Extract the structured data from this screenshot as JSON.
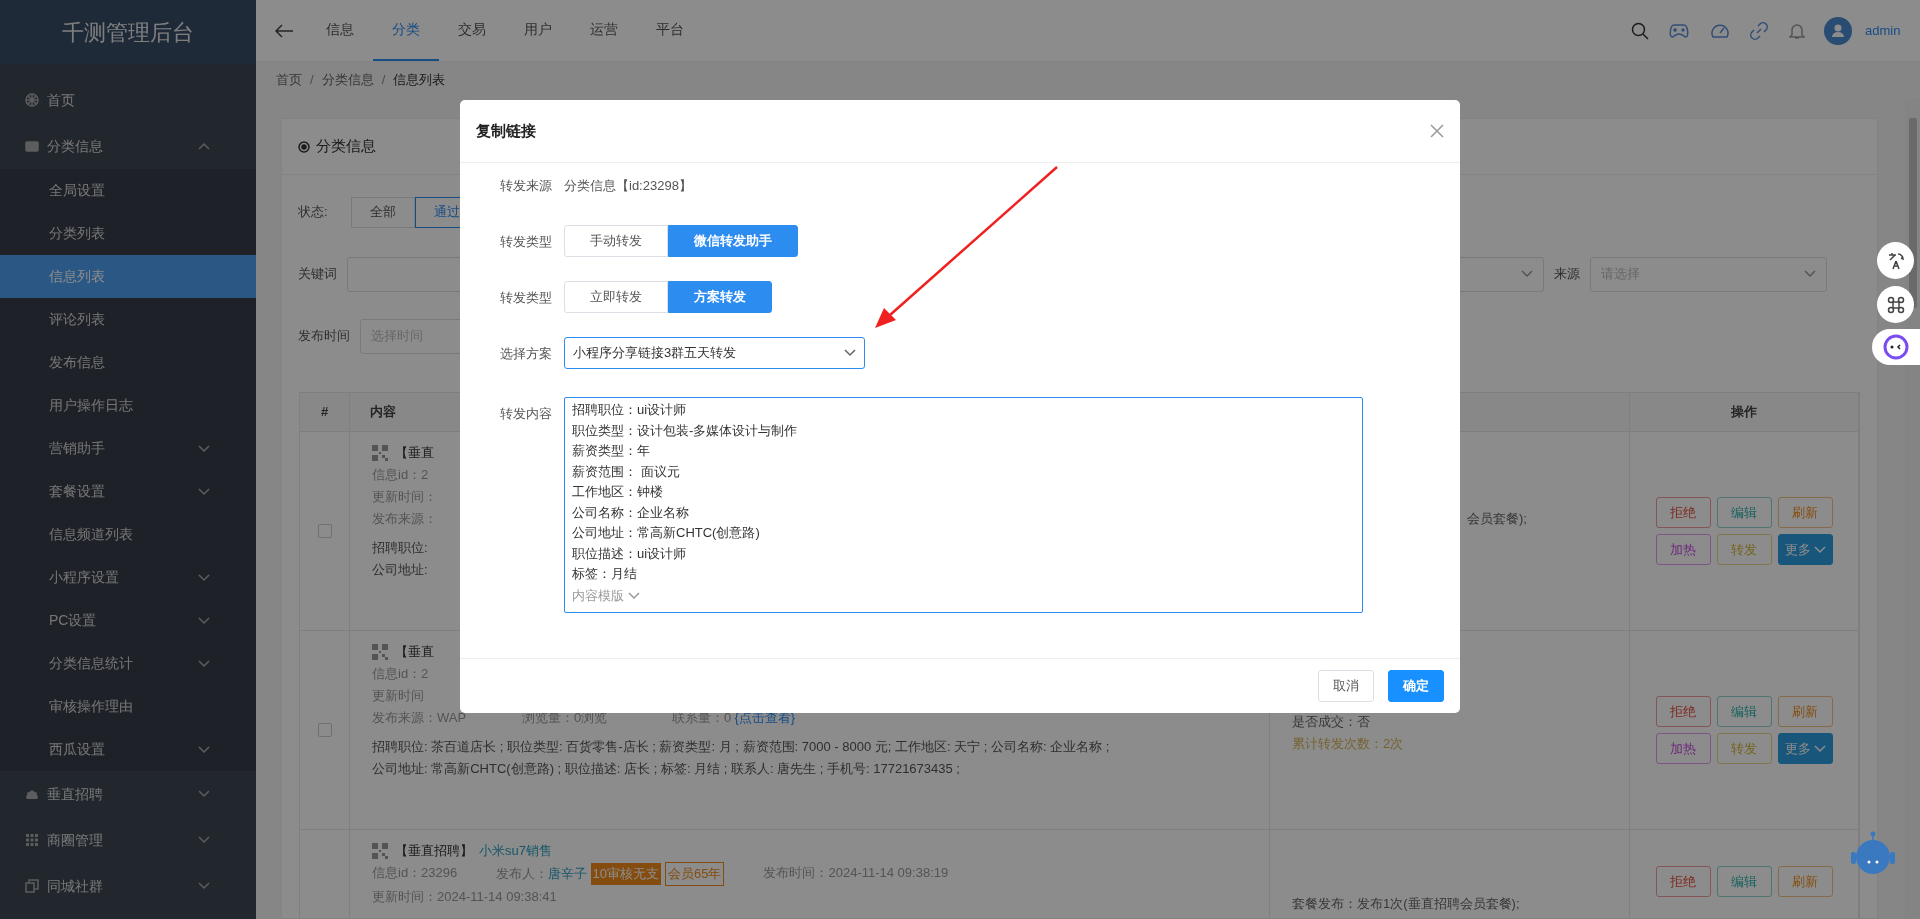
{
  "sidebar": {
    "title": "千测管理后台",
    "items": [
      {
        "label": "首页",
        "kind": "link"
      },
      {
        "label": "分类信息",
        "kind": "group",
        "expanded": true,
        "children": [
          {
            "label": "全局设置",
            "kind": "link",
            "selected": false
          },
          {
            "label": "分类列表",
            "kind": "link",
            "selected": false
          },
          {
            "label": "信息列表",
            "kind": "link",
            "selected": true
          },
          {
            "label": "评论列表",
            "kind": "link",
            "selected": false
          },
          {
            "label": "发布信息",
            "kind": "link",
            "selected": false
          },
          {
            "label": "用户操作日志",
            "kind": "link",
            "selected": false
          },
          {
            "label": "营销助手",
            "kind": "group",
            "expanded": false
          },
          {
            "label": "套餐设置",
            "kind": "group",
            "expanded": false
          },
          {
            "label": "信息频道列表",
            "kind": "link",
            "selected": false
          },
          {
            "label": "小程序设置",
            "kind": "group",
            "expanded": false
          },
          {
            "label": "PC设置",
            "kind": "group",
            "expanded": false
          },
          {
            "label": "分类信息统计",
            "kind": "group",
            "expanded": false
          },
          {
            "label": "审核操作理由",
            "kind": "link",
            "selected": false
          },
          {
            "label": "西瓜设置",
            "kind": "group",
            "expanded": false
          }
        ]
      },
      {
        "label": "垂直招聘",
        "kind": "group",
        "expanded": false
      },
      {
        "label": "商圈管理",
        "kind": "group",
        "expanded": false
      },
      {
        "label": "同城社群",
        "kind": "group",
        "expanded": false
      }
    ]
  },
  "top_nav": {
    "tabs": [
      {
        "label": "信息",
        "selected": false
      },
      {
        "label": "分类",
        "selected": true
      },
      {
        "label": "交易",
        "selected": false
      },
      {
        "label": "用户",
        "selected": false
      },
      {
        "label": "运营",
        "selected": false
      },
      {
        "label": "平台",
        "selected": false
      }
    ],
    "user": "admin"
  },
  "breadcrumb": [
    "首页",
    "分类信息",
    "信息列表"
  ],
  "breadcrumb_separator": "/",
  "card": {
    "title": "分类信息",
    "filters": {
      "status_label": "状态:",
      "status_options": [
        {
          "label": "全部",
          "selected": false
        },
        {
          "label": "通过",
          "selected": true
        }
      ],
      "keyword_label": "关键词",
      "source_label": "来源",
      "source_placeholder": "请选择",
      "time_label": "发布时间",
      "time_placeholder": "选择时间"
    },
    "table": {
      "header": {
        "index": "#",
        "content": "内容",
        "actions": "操作"
      },
      "rows": [
        {
          "checked": false,
          "title": "【垂直",
          "lines": [
            "信息id：2",
            "更新时间：",
            "发布来源："
          ],
          "desc": [
            "招聘职位:",
            "公司地址:"
          ],
          "side": [
            {
              "text": "会员套餐);",
              "kind": "plain"
            }
          ],
          "actions": [
            {
              "label": "拒绝",
              "kind": "reject"
            },
            {
              "label": "编辑",
              "kind": "edit"
            },
            {
              "label": "刷新",
              "kind": "refresh"
            },
            {
              "label": "加热",
              "kind": "boost"
            },
            {
              "label": "转发",
              "kind": "forward"
            },
            {
              "label": "更多",
              "kind": "more"
            }
          ]
        },
        {
          "checked": false,
          "title": "【垂直",
          "lines": [
            "信息id：2",
            "更新时间"
          ],
          "meta": {
            "source": "发布来源：WAP",
            "views": "浏览量：0浏览",
            "contacts": "联系量：0",
            "link": "{点击查看}"
          },
          "desc": [
            "招聘职位: 茶百道店长 ; 职位类型: 百货零售-店长 ; 薪资类型: 月 ; 薪资范围: 7000 - 8000 元; 工作地区: 天宁 ; 公司名称: 企业名称 ;",
            "公司地址: 常高新CHTC(创意路) ; 职位描述: 店长 ; 标签: 月结 ; 联系人: 唐先生 ; 手机号: 17721673435 ;"
          ],
          "side": [
            {
              "text": "是否成交：否",
              "kind": "plain"
            },
            {
              "text": "累计转发次数：2次",
              "kind": "highlight"
            }
          ],
          "actions": [
            {
              "label": "拒绝",
              "kind": "reject"
            },
            {
              "label": "编辑",
              "kind": "edit"
            },
            {
              "label": "刷新",
              "kind": "refresh"
            },
            {
              "label": "加热",
              "kind": "boost"
            },
            {
              "label": "转发",
              "kind": "forward"
            },
            {
              "label": "更多",
              "kind": "more"
            }
          ]
        },
        {
          "title": "【垂直招聘】",
          "title_link": "小米su7销售",
          "info": {
            "id": "信息id：23296",
            "publisher_label": "发布人：",
            "publisher": "唐辛子",
            "tags": [
              {
                "text": "10审核无支",
                "kind": "filled"
              },
              {
                "text": "会员65年",
                "kind": "outline"
              }
            ],
            "time": "发布时间：2024-11-14 09:38:19"
          },
          "lines": [
            "更新时间：2024-11-14 09:38:41"
          ],
          "side": [
            {
              "text": "套餐发布：发布1次(垂直招聘会员套餐);",
              "kind": "plain"
            }
          ],
          "actions": [
            {
              "label": "拒绝",
              "kind": "reject"
            },
            {
              "label": "编辑",
              "kind": "edit"
            },
            {
              "label": "刷新",
              "kind": "refresh"
            }
          ]
        }
      ]
    }
  },
  "modal": {
    "title": "复制链接",
    "source_label": "转发来源",
    "source_value": "分类信息【id:23298】",
    "segments": [
      {
        "label": "转发类型",
        "options": [
          {
            "label": "手动转发",
            "selected": false
          },
          {
            "label": "微信转发助手",
            "selected": true
          }
        ]
      },
      {
        "label": "转发类型",
        "options": [
          {
            "label": "立即转发",
            "selected": false
          },
          {
            "label": "方案转发",
            "selected": true
          }
        ]
      }
    ],
    "plan_label": "选择方案",
    "plan_value": "小程序分享链接3群五天转发",
    "content_label": "转发内容",
    "content_lines": [
      "招聘职位：ui设计师",
      "职位类型：设计包装-多媒体设计与制作",
      "薪资类型：年",
      "薪资范围： 面议元",
      "工作地区：钟楼",
      "公司名称：企业名称",
      "公司地址：常高新CHTC(创意路)",
      "职位描述：ui设计师",
      "标签：月结"
    ],
    "template_link": "内容模版",
    "buttons": [
      {
        "label": "取消",
        "kind": "secondary"
      },
      {
        "label": "确定",
        "kind": "primary"
      }
    ]
  }
}
